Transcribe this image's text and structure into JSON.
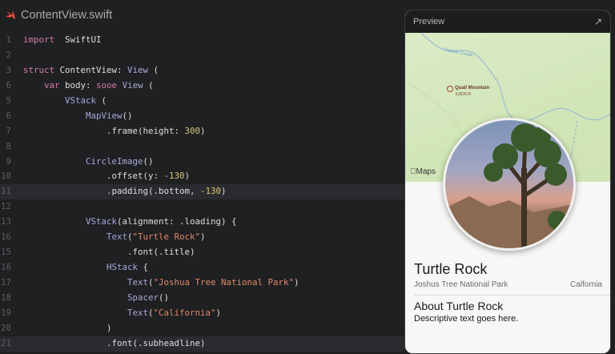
{
  "editor": {
    "file_name": "ContentView.swift",
    "icon": "swift-icon",
    "highlight_lines": [
      10,
      20
    ],
    "lines": [
      {
        "n": "1",
        "segs": [
          [
            "kw",
            "import"
          ],
          [
            "",
            "  SwiftUI"
          ]
        ]
      },
      {
        "n": "2",
        "segs": []
      },
      {
        "n": "3",
        "segs": [
          [
            "kw",
            "struct"
          ],
          [
            "",
            " ContentView: "
          ],
          [
            "ty",
            "View"
          ],
          [
            "",
            " ("
          ]
        ]
      },
      {
        "n": "6",
        "segs": [
          [
            "",
            "    "
          ],
          [
            "kw",
            "var"
          ],
          [
            "",
            " body: "
          ],
          [
            "kw",
            "sooe"
          ],
          [
            "",
            " "
          ],
          [
            "ty",
            "View"
          ],
          [
            "",
            " ("
          ]
        ]
      },
      {
        "n": "5",
        "segs": [
          [
            "ty",
            "        VStack"
          ],
          [
            "",
            " ("
          ]
        ]
      },
      {
        "n": "6",
        "segs": [
          [
            "ty",
            "            MapView"
          ],
          [
            "",
            "()"
          ]
        ]
      },
      {
        "n": "7",
        "segs": [
          [
            "",
            "                .frame(height: "
          ],
          [
            "nu",
            "300"
          ],
          [
            "",
            ")"
          ]
        ]
      },
      {
        "n": "8",
        "segs": []
      },
      {
        "n": "9",
        "segs": [
          [
            "ty",
            "            CircleImage"
          ],
          [
            "",
            "()"
          ]
        ]
      },
      {
        "n": "10",
        "segs": [
          [
            "",
            "                .offset(y: "
          ],
          [
            "nu",
            "-130"
          ],
          [
            "",
            ")"
          ]
        ]
      },
      {
        "n": "11",
        "segs": [
          [
            "",
            "                .padding(.bottom, "
          ],
          [
            "nu",
            "-130"
          ],
          [
            "",
            ")"
          ]
        ]
      },
      {
        "n": "12",
        "segs": []
      },
      {
        "n": "13",
        "segs": [
          [
            "ty",
            "            VStack"
          ],
          [
            "",
            "(alignment: .loading) {"
          ]
        ]
      },
      {
        "n": "16",
        "segs": [
          [
            "ty",
            "                Text"
          ],
          [
            "",
            "("
          ],
          [
            "st",
            "\"Turtle Rock\""
          ],
          [
            "",
            ")"
          ]
        ]
      },
      {
        "n": "15",
        "segs": [
          [
            "",
            "                    .font(.title)"
          ]
        ]
      },
      {
        "n": "16",
        "segs": [
          [
            "ty",
            "                HStack"
          ],
          [
            "",
            " {"
          ]
        ]
      },
      {
        "n": "17",
        "segs": [
          [
            "ty",
            "                    Text"
          ],
          [
            "",
            "("
          ],
          [
            "st",
            "\"Joshua Tree National Park\""
          ],
          [
            "",
            ")"
          ]
        ]
      },
      {
        "n": "18",
        "segs": [
          [
            "ty",
            "                    Spacer"
          ],
          [
            "",
            "()"
          ]
        ]
      },
      {
        "n": "19",
        "segs": [
          [
            "ty",
            "                    Text"
          ],
          [
            "",
            "("
          ],
          [
            "st",
            "\"California\""
          ],
          [
            "",
            ")"
          ]
        ]
      },
      {
        "n": "20",
        "segs": [
          [
            "",
            "                )"
          ]
        ]
      },
      {
        "n": "21",
        "segs": [
          [
            "",
            "                .font(.subheadline)"
          ]
        ]
      }
    ]
  },
  "preview": {
    "title": "Preview",
    "expand_icon": "arrow-up-right-icon",
    "map": {
      "place_label": "Quail Mountain",
      "place_sub": "5,8OO ft",
      "river_label": "Coyote Creek",
      "maps_label": "Maps"
    },
    "place_title": "Turtle Rock",
    "park": "Joshus Tree National Park",
    "state": "Calfornia",
    "about_title": "About Turtle Rock",
    "description": "Descriptive text goes here."
  }
}
